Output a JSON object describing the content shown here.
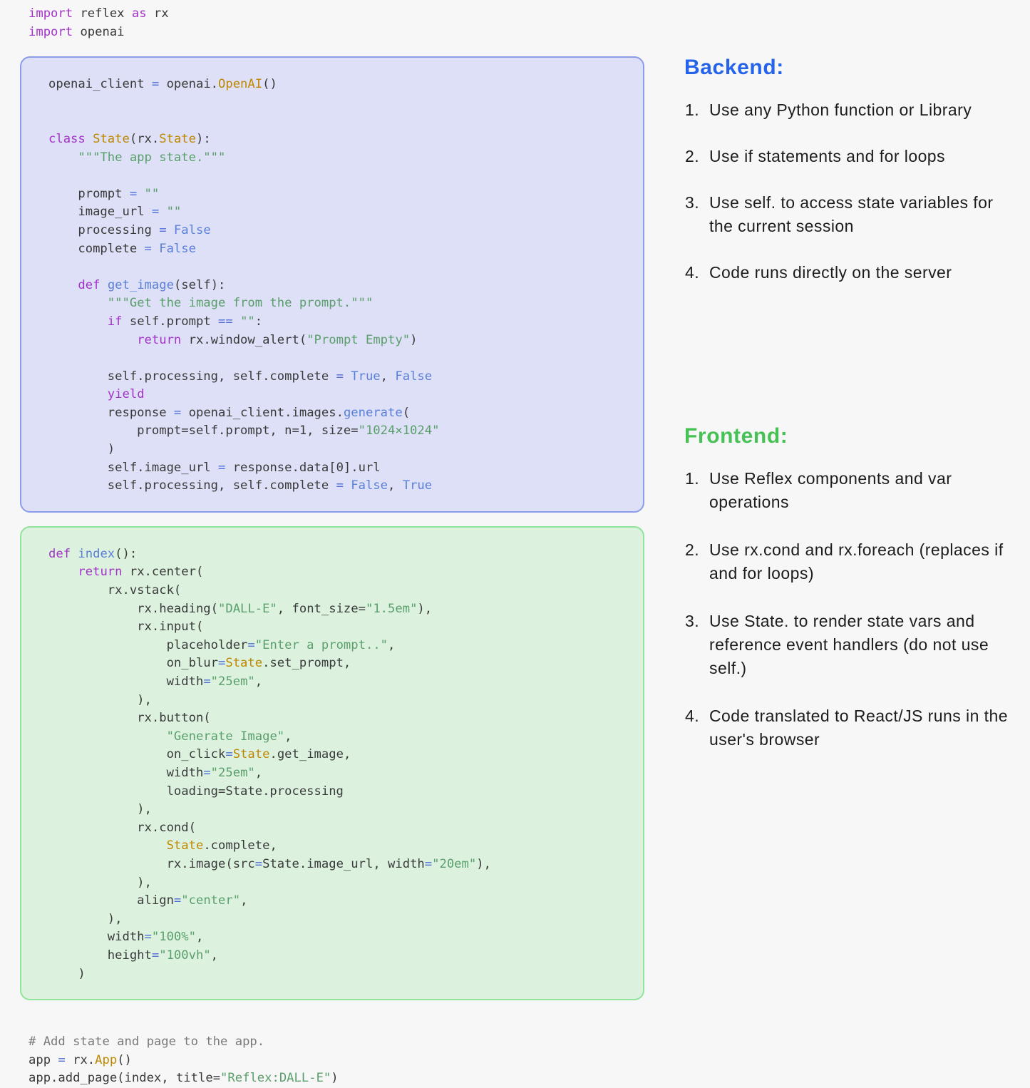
{
  "code": {
    "imports": [
      [
        {
          "t": "import ",
          "c": "kw"
        },
        {
          "t": "reflex ",
          "c": "pln"
        },
        {
          "t": "as ",
          "c": "kw"
        },
        {
          "t": "rx",
          "c": "pln"
        }
      ],
      [
        {
          "t": "import ",
          "c": "kw"
        },
        {
          "t": "openai",
          "c": "pln"
        }
      ]
    ],
    "backend_block": [
      [
        {
          "t": "openai_client ",
          "c": "pln"
        },
        {
          "t": "= ",
          "c": "op"
        },
        {
          "t": "openai.",
          "c": "pln"
        },
        {
          "t": "OpenAI",
          "c": "cls"
        },
        {
          "t": "()",
          "c": "pln"
        }
      ],
      [],
      [],
      [
        {
          "t": "class ",
          "c": "kw"
        },
        {
          "t": "State",
          "c": "cls"
        },
        {
          "t": "(rx.",
          "c": "pln"
        },
        {
          "t": "State",
          "c": "cls"
        },
        {
          "t": "):",
          "c": "pln"
        }
      ],
      [
        {
          "t": "    \"\"\"The app state.\"\"\"",
          "c": "str"
        }
      ],
      [],
      [
        {
          "t": "    prompt ",
          "c": "pln"
        },
        {
          "t": "= ",
          "c": "op"
        },
        {
          "t": "\"\"",
          "c": "str"
        }
      ],
      [
        {
          "t": "    image_url ",
          "c": "pln"
        },
        {
          "t": "= ",
          "c": "op"
        },
        {
          "t": "\"\"",
          "c": "str"
        }
      ],
      [
        {
          "t": "    processing ",
          "c": "pln"
        },
        {
          "t": "= ",
          "c": "op"
        },
        {
          "t": "False",
          "c": "bool"
        }
      ],
      [
        {
          "t": "    complete ",
          "c": "pln"
        },
        {
          "t": "= ",
          "c": "op"
        },
        {
          "t": "False",
          "c": "bool"
        }
      ],
      [],
      [
        {
          "t": "    ",
          "c": "pln"
        },
        {
          "t": "def ",
          "c": "kw"
        },
        {
          "t": "get_image",
          "c": "fn"
        },
        {
          "t": "(self):",
          "c": "pln"
        }
      ],
      [
        {
          "t": "        \"\"\"Get the image from the prompt.\"\"\"",
          "c": "str"
        }
      ],
      [
        {
          "t": "        ",
          "c": "pln"
        },
        {
          "t": "if ",
          "c": "kw"
        },
        {
          "t": "self.prompt ",
          "c": "pln"
        },
        {
          "t": "== ",
          "c": "op"
        },
        {
          "t": "\"\"",
          "c": "str"
        },
        {
          "t": ":",
          "c": "pln"
        }
      ],
      [
        {
          "t": "            ",
          "c": "pln"
        },
        {
          "t": "return ",
          "c": "kw"
        },
        {
          "t": "rx.window_alert(",
          "c": "pln"
        },
        {
          "t": "\"Prompt Empty\"",
          "c": "str"
        },
        {
          "t": ")",
          "c": "pln"
        }
      ],
      [],
      [
        {
          "t": "        self.processing, self.complete ",
          "c": "pln"
        },
        {
          "t": "= ",
          "c": "op"
        },
        {
          "t": "True",
          "c": "bool"
        },
        {
          "t": ", ",
          "c": "pln"
        },
        {
          "t": "False",
          "c": "bool"
        }
      ],
      [
        {
          "t": "        ",
          "c": "pln"
        },
        {
          "t": "yield",
          "c": "kw"
        }
      ],
      [
        {
          "t": "        response ",
          "c": "pln"
        },
        {
          "t": "= ",
          "c": "op"
        },
        {
          "t": "openai_client.images.",
          "c": "pln"
        },
        {
          "t": "generate",
          "c": "fn"
        },
        {
          "t": "(",
          "c": "pln"
        }
      ],
      [
        {
          "t": "            prompt=self.prompt, n=1, size=",
          "c": "pln"
        },
        {
          "t": "\"1024×1024\"",
          "c": "str"
        }
      ],
      [
        {
          "t": "        )",
          "c": "pln"
        }
      ],
      [
        {
          "t": "        self.image_url ",
          "c": "pln"
        },
        {
          "t": "= ",
          "c": "op"
        },
        {
          "t": "response.data[0].url",
          "c": "pln"
        }
      ],
      [
        {
          "t": "        self.processing, self.complete ",
          "c": "pln"
        },
        {
          "t": "= ",
          "c": "op"
        },
        {
          "t": "False",
          "c": "bool"
        },
        {
          "t": ", ",
          "c": "pln"
        },
        {
          "t": "True",
          "c": "bool"
        }
      ]
    ],
    "frontend_block": [
      [
        {
          "t": "def ",
          "c": "kw"
        },
        {
          "t": "index",
          "c": "fn"
        },
        {
          "t": "():",
          "c": "pln"
        }
      ],
      [
        {
          "t": "    ",
          "c": "pln"
        },
        {
          "t": "return ",
          "c": "kw"
        },
        {
          "t": "rx.center(",
          "c": "pln"
        }
      ],
      [
        {
          "t": "        rx.vstack(",
          "c": "pln"
        }
      ],
      [
        {
          "t": "            rx.heading(",
          "c": "pln"
        },
        {
          "t": "\"DALL-E\"",
          "c": "str"
        },
        {
          "t": ", font_size=",
          "c": "pln"
        },
        {
          "t": "\"1.5em\"",
          "c": "str"
        },
        {
          "t": "),",
          "c": "pln"
        }
      ],
      [
        {
          "t": "            rx.input(",
          "c": "pln"
        }
      ],
      [
        {
          "t": "                placeholder",
          "c": "pln"
        },
        {
          "t": "=",
          "c": "op"
        },
        {
          "t": "\"Enter a prompt..\"",
          "c": "str"
        },
        {
          "t": ",",
          "c": "pln"
        }
      ],
      [
        {
          "t": "                on_blur",
          "c": "pln"
        },
        {
          "t": "=",
          "c": "op"
        },
        {
          "t": "State",
          "c": "cls"
        },
        {
          "t": ".set_prompt,",
          "c": "pln"
        }
      ],
      [
        {
          "t": "                width",
          "c": "pln"
        },
        {
          "t": "=",
          "c": "op"
        },
        {
          "t": "\"25em\"",
          "c": "str"
        },
        {
          "t": ",",
          "c": "pln"
        }
      ],
      [
        {
          "t": "            ),",
          "c": "pln"
        }
      ],
      [
        {
          "t": "            rx.button(",
          "c": "pln"
        }
      ],
      [
        {
          "t": "                ",
          "c": "pln"
        },
        {
          "t": "\"Generate Image\"",
          "c": "str"
        },
        {
          "t": ",",
          "c": "pln"
        }
      ],
      [
        {
          "t": "                on_click",
          "c": "pln"
        },
        {
          "t": "=",
          "c": "op"
        },
        {
          "t": "State",
          "c": "cls"
        },
        {
          "t": ".get_image,",
          "c": "pln"
        }
      ],
      [
        {
          "t": "                width",
          "c": "pln"
        },
        {
          "t": "=",
          "c": "op"
        },
        {
          "t": "\"25em\"",
          "c": "str"
        },
        {
          "t": ",",
          "c": "pln"
        }
      ],
      [
        {
          "t": "                loading=State.processing",
          "c": "pln"
        }
      ],
      [
        {
          "t": "            ),",
          "c": "pln"
        }
      ],
      [
        {
          "t": "            rx.cond(",
          "c": "pln"
        }
      ],
      [
        {
          "t": "                ",
          "c": "pln"
        },
        {
          "t": "State",
          "c": "cls"
        },
        {
          "t": ".complete,",
          "c": "pln"
        }
      ],
      [
        {
          "t": "                rx.image(src",
          "c": "pln"
        },
        {
          "t": "=",
          "c": "op"
        },
        {
          "t": "State.image_url, width",
          "c": "pln"
        },
        {
          "t": "=",
          "c": "op"
        },
        {
          "t": "\"20em\"",
          "c": "str"
        },
        {
          "t": "),",
          "c": "pln"
        }
      ],
      [
        {
          "t": "            ),",
          "c": "pln"
        }
      ],
      [
        {
          "t": "            align",
          "c": "pln"
        },
        {
          "t": "=",
          "c": "op"
        },
        {
          "t": "\"center\"",
          "c": "str"
        },
        {
          "t": ",",
          "c": "pln"
        }
      ],
      [
        {
          "t": "        ),",
          "c": "pln"
        }
      ],
      [
        {
          "t": "        width",
          "c": "pln"
        },
        {
          "t": "=",
          "c": "op"
        },
        {
          "t": "\"100%\"",
          "c": "str"
        },
        {
          "t": ",",
          "c": "pln"
        }
      ],
      [
        {
          "t": "        height",
          "c": "pln"
        },
        {
          "t": "=",
          "c": "op"
        },
        {
          "t": "\"100vh\"",
          "c": "str"
        },
        {
          "t": ",",
          "c": "pln"
        }
      ],
      [
        {
          "t": "    )",
          "c": "pln"
        }
      ]
    ],
    "footer_block": [
      [
        {
          "t": "# Add state and page to the app.",
          "c": "cmt"
        }
      ],
      [
        {
          "t": "app ",
          "c": "pln"
        },
        {
          "t": "= ",
          "c": "op"
        },
        {
          "t": "rx.",
          "c": "pln"
        },
        {
          "t": "App",
          "c": "cls"
        },
        {
          "t": "()",
          "c": "pln"
        }
      ],
      [
        {
          "t": "app.add_page(index, title=",
          "c": "pln"
        },
        {
          "t": "\"Reflex:DALL-E\"",
          "c": "str"
        },
        {
          "t": ")",
          "c": "pln"
        }
      ]
    ]
  },
  "panels": {
    "backend": {
      "heading": "Backend:",
      "color": "#2563eb",
      "items": [
        {
          "num": "1.",
          "text": "Use any Python function or Library"
        },
        {
          "num": "2.",
          "text": "Use if statements and for loops"
        },
        {
          "num": "3.",
          "text": "Use self. to access state variables for the current session"
        },
        {
          "num": "4.",
          "text": "Code runs directly on the server"
        }
      ]
    },
    "frontend": {
      "heading": "Frontend:",
      "color": "#45c155",
      "items": [
        {
          "num": "1.",
          "text": "Use Reflex components and var operations"
        },
        {
          "num": "2.",
          "text": "Use rx.cond and rx.foreach (replaces if and for loops)"
        },
        {
          "num": "3.",
          "text": "Use State. to render state vars and reference event handlers (do not use self.)"
        },
        {
          "num": "4.",
          "text": "Code translated to React/JS runs in the user's browser"
        }
      ]
    }
  },
  "theme": {
    "page_background": "#f7f7f7",
    "backend_block_background": "#dee0f7",
    "backend_block_border": "#8a9cea",
    "frontend_block_background": "#dcf2df",
    "frontend_block_border": "#92e39c"
  }
}
